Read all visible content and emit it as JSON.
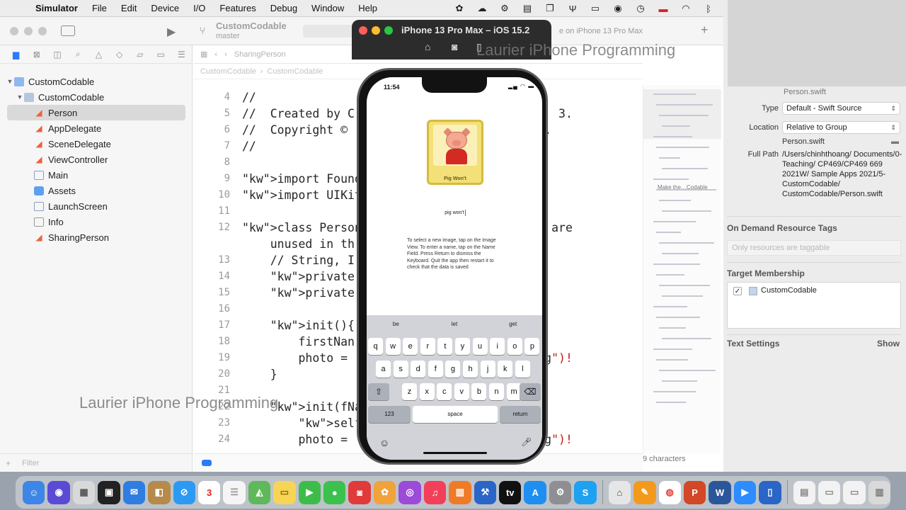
{
  "menubar": {
    "app_name": "Simulator",
    "items": [
      "File",
      "Edit",
      "Device",
      "I/O",
      "Features",
      "Debug",
      "Window",
      "Help"
    ]
  },
  "xcode": {
    "project_name": "CustomCodable",
    "branch": "master",
    "run_destination": "e on iPhone 13 Pro Max",
    "jump_file": "SharingPerson",
    "breadcrumb": [
      "CustomCodable",
      "CustomCodable"
    ],
    "navigator": {
      "project": "CustomCodable",
      "group": "CustomCodable",
      "files": [
        "Person",
        "AppDelegate",
        "SceneDelegate",
        "ViewController",
        "Main",
        "Assets",
        "LaunchScreen",
        "Info",
        "SharingPerson"
      ],
      "selected": "Person",
      "filter_placeholder": "Filter"
    },
    "code_lines": [
      {
        "n": "4",
        "t": "//"
      },
      {
        "n": "5",
        "t": "//  Created by C                             3."
      },
      {
        "n": "6",
        "t": "//  Copyright ©                        rved."
      },
      {
        "n": "7",
        "t": "//"
      },
      {
        "n": "8",
        "t": ""
      },
      {
        "n": "9",
        "t": "import Foundati"
      },
      {
        "n": "10",
        "t": "import UIKit"
      },
      {
        "n": "11",
        "t": ""
      },
      {
        "n": "12",
        "t": "class Person: Co                 rties are"
      },
      {
        "n": "",
        "t": "    unused in th"
      },
      {
        "n": "13",
        "t": "    // String, I                Codable"
      },
      {
        "n": "14",
        "t": "    private var"
      },
      {
        "n": "15",
        "t": "    private var"
      },
      {
        "n": "16",
        "t": ""
      },
      {
        "n": "17",
        "t": "    init(){"
      },
      {
        "n": "18",
        "t": "        firstNan"
      },
      {
        "n": "19",
        "t": "        photo =                     ark.jpeg\")!"
      },
      {
        "n": "20",
        "t": "    }"
      },
      {
        "n": "21",
        "t": ""
      },
      {
        "n": "22",
        "t": "    init(fName:"
      },
      {
        "n": "23",
        "t": "        self.fir"
      },
      {
        "n": "24",
        "t": "        photo =                     ark.jpeg\")!"
      }
    ],
    "minimap_label": "Make the…Codable",
    "char_count": "9 characters"
  },
  "inspector": {
    "name_value": "Person.swift",
    "type_label": "Type",
    "type_value": "Default - Swift Source",
    "location_label": "Location",
    "location_value": "Relative to Group",
    "file_name": "Person.swift",
    "full_path_label": "Full Path",
    "full_path": "/Users/chinhthoang/ Documents/0-Teaching/ CP469/CP469 669 2021W/ Sample Apps 2021/5- CustomCodable/ CustomCodable/Person.swift",
    "on_demand_title": "On Demand Resource Tags",
    "on_demand_placeholder": "Only resources are taggable",
    "target_membership_title": "Target Membership",
    "target_name": "CustomCodable",
    "text_settings_title": "Text Settings",
    "show_label": "Show"
  },
  "simulator": {
    "title": "iPhone 13 Pro Max – iOS 15.2",
    "status_time": "11:54",
    "pig_caption": "Pig Won't",
    "name_field_value": "pig won't",
    "instructions": "To select a new image, tap on the Image View. To enter a name, tap on the Name Field. Press Return to dismiss the Keyboard. Quit the app then restart it to check that the data is saved",
    "suggestions": [
      "be",
      "let",
      "get"
    ],
    "keyboard_rows": [
      [
        "q",
        "w",
        "e",
        "r",
        "t",
        "y",
        "u",
        "i",
        "o",
        "p"
      ],
      [
        "a",
        "s",
        "d",
        "f",
        "g",
        "h",
        "j",
        "k",
        "l"
      ],
      [
        "z",
        "x",
        "c",
        "v",
        "b",
        "n",
        "m"
      ]
    ],
    "key_123": "123",
    "key_space": "space",
    "key_return": "return"
  },
  "watermark": "Laurier iPhone Programming",
  "dock": {
    "calendar_day": "3"
  },
  "colors": {
    "accent": "#2a7cf6",
    "keyword": "#9b2393",
    "string": "#c41a16",
    "close": "#ff5f57",
    "minimize": "#febc2e",
    "zoom": "#28c840"
  }
}
